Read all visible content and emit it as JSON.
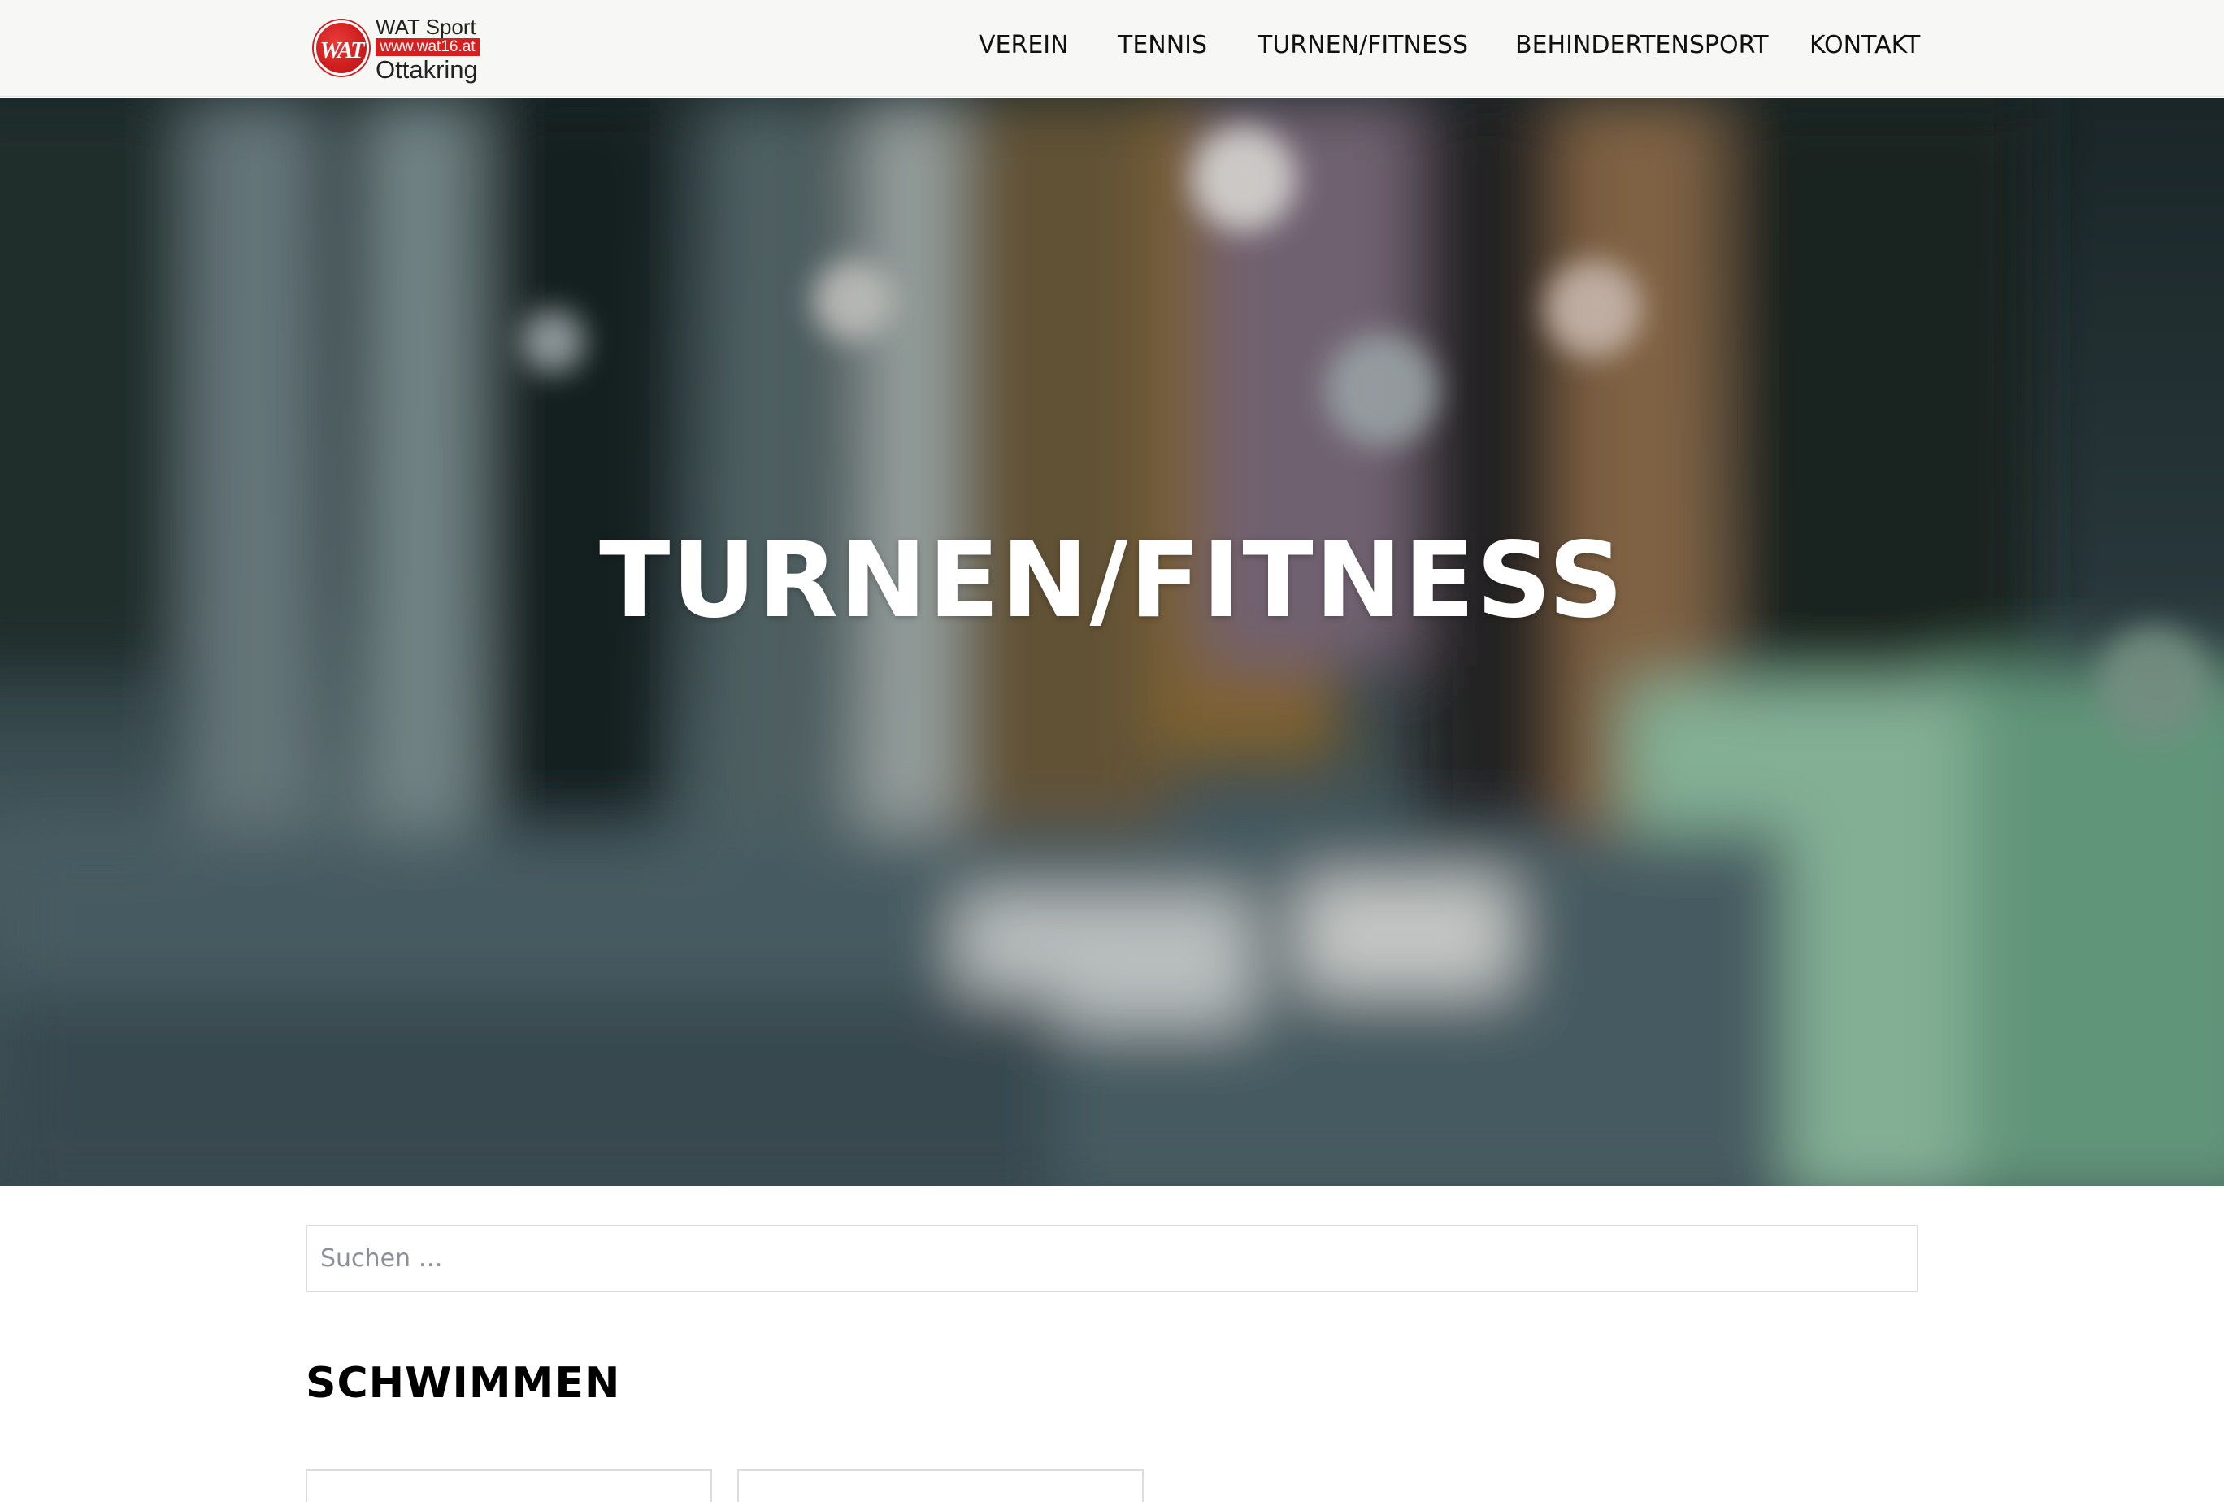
{
  "header": {
    "logo": {
      "mark": "WAT",
      "top_text": "WAT Sport",
      "url_text": "www.wat16.at",
      "bottom_text": "Ottakring",
      "brand_color": "#d62020"
    },
    "nav": [
      {
        "label": "VEREIN"
      },
      {
        "label": "TENNIS"
      },
      {
        "label": "TURNEN/FITNESS"
      },
      {
        "label": "BEHINDERTENSPORT"
      },
      {
        "label": "KONTAKT"
      }
    ]
  },
  "hero": {
    "title": "TURNEN/FITNESS"
  },
  "search": {
    "placeholder": "Suchen …",
    "value": ""
  },
  "main": {
    "section_title": "SCHWIMMEN"
  },
  "colors": {
    "header_bg": "#f7f7f6",
    "hero_text": "#ffffff",
    "body_bg": "#ffffff"
  }
}
